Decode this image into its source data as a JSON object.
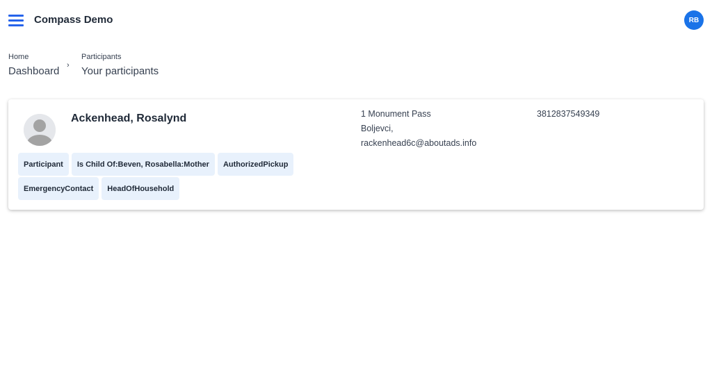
{
  "header": {
    "app_title": "Compass Demo",
    "user_initials": "RB",
    "accent_color": "#2563eb",
    "menu_icon": "hamburger-menu-icon"
  },
  "breadcrumb": {
    "home": {
      "caption": "Home",
      "label": "Dashboard"
    },
    "separator": "›",
    "current": {
      "caption": "Participants",
      "label": "Your participants"
    }
  },
  "participant": {
    "name": "Ackenhead, Rosalynd",
    "avatar_icon": "person-placeholder-icon",
    "address_line1": "1 Monument Pass",
    "address_line2": "Boljevci,",
    "email": "rackenhead6c@aboutads.info",
    "phone": "3812837549349",
    "tags_row1": [
      "Participant",
      "Is Child Of:Beven, Rosabella:Mother",
      "AuthorizedPickup"
    ],
    "tags_row2": [
      "EmergencyContact",
      "HeadOfHousehold"
    ],
    "tag_color": "#e8f1fc"
  }
}
